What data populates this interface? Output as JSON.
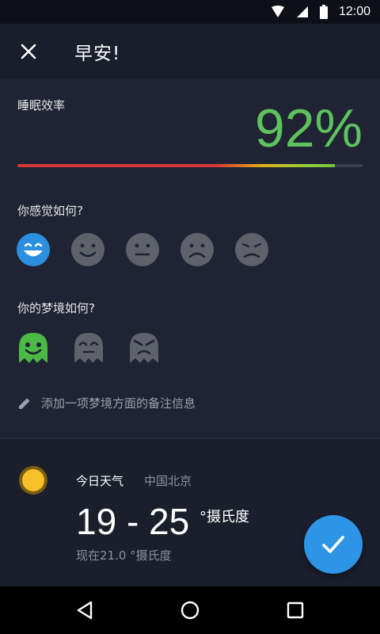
{
  "status_bar": {
    "time": "12:00",
    "icons": [
      "wifi-icon",
      "signal-icon",
      "battery-icon"
    ]
  },
  "header": {
    "close_icon": "close-icon",
    "title": "早安!"
  },
  "sleep": {
    "label": "睡眠效率",
    "value": "92%",
    "progress_fraction": 0.92
  },
  "mood": {
    "question": "你感觉如何?",
    "options": [
      "very-happy-face-icon",
      "smile-face-icon",
      "neutral-face-icon",
      "frown-face-icon",
      "sad-face-icon"
    ],
    "selected_index": 0
  },
  "dream": {
    "question": "你的梦境如何?",
    "options": [
      "happy-ghost-icon",
      "neutral-ghost-icon",
      "angry-ghost-icon"
    ],
    "selected_index": 0
  },
  "note": {
    "icon": "pencil-icon",
    "text": "添加一项梦境方面的备注信息"
  },
  "weather": {
    "icon": "sun-icon",
    "title": "今日天气",
    "location": "中国北京",
    "range": "19 - 25",
    "unit": "°摄氏度",
    "current": "现在21.0 °摄氏度"
  },
  "fab": {
    "icon": "check-icon"
  },
  "nav": {
    "icons": [
      "back-icon",
      "home-icon",
      "recents-icon"
    ]
  },
  "colors": {
    "accent_blue": "#2d95e5",
    "efficiency_green": "#5ec25e",
    "selected_mood": "#2b8fe0",
    "selected_dream": "#4cb944",
    "inactive_icon": "#5f626b",
    "background": "#1f2333"
  }
}
